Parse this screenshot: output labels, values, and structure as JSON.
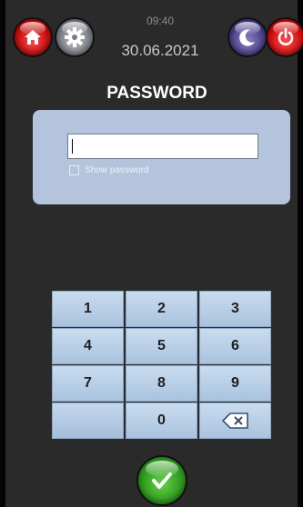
{
  "header": {
    "time": "09:40",
    "date": "30.06.2021",
    "icons": {
      "home": "home-icon",
      "settings": "gear-icon",
      "night": "moon-icon",
      "power": "power-icon"
    }
  },
  "password": {
    "title": "PASSWORD",
    "value": "",
    "show_password_label": "Show password",
    "show_password_checked": false
  },
  "keypad": {
    "keys": [
      "1",
      "2",
      "3",
      "4",
      "5",
      "6",
      "7",
      "8",
      "9",
      "",
      "0",
      "backspace-icon"
    ]
  },
  "footer": {
    "ok_icon": "check-icon"
  },
  "colors": {
    "background": "#2a2a2a",
    "panel": "#b4c4dc",
    "key": "#b9cfe6",
    "danger": "#d40000",
    "confirm": "#2da11d"
  }
}
